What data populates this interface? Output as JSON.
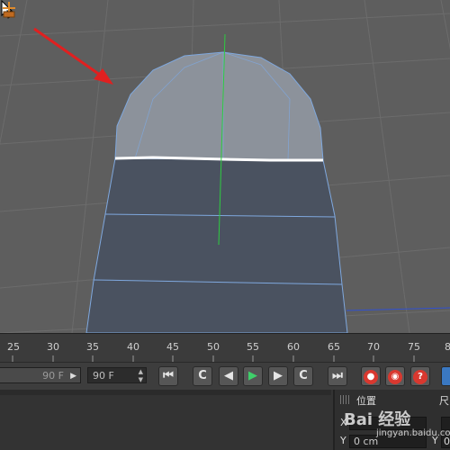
{
  "timeline": {
    "ticks": [
      "25",
      "30",
      "35",
      "40",
      "45",
      "50",
      "55",
      "60",
      "65",
      "70",
      "75",
      "8"
    ]
  },
  "transport": {
    "start_frame": "90 F",
    "end_frame": "90 F",
    "buttons": {
      "go_start": "⏮",
      "prev_key": "C",
      "prev_frame": "◀",
      "play": "▶",
      "next_frame": "▶",
      "next_key": "C",
      "go_end": "⏭",
      "record": "●",
      "autokey": "◉",
      "help": "?"
    }
  },
  "attributes": {
    "title": "位置",
    "title2": "尺",
    "x_label": "X",
    "x_value": "",
    "y_label": "Y",
    "y_value": "0 cm",
    "y2_value": "0"
  },
  "watermark": {
    "brand": "Bai 经验",
    "url": "jingyan.baidu.com"
  },
  "colors": {
    "viewport_bg": "#5e5e5e",
    "grid_line": "#6a6a6a",
    "object_fill": "#4a5260",
    "highlight_fill": "#8a909a",
    "edge_color": "#7fa8de",
    "arrow_red": "#e02020",
    "axis_green": "#2ecc40",
    "play_green": "#3fd06a"
  }
}
